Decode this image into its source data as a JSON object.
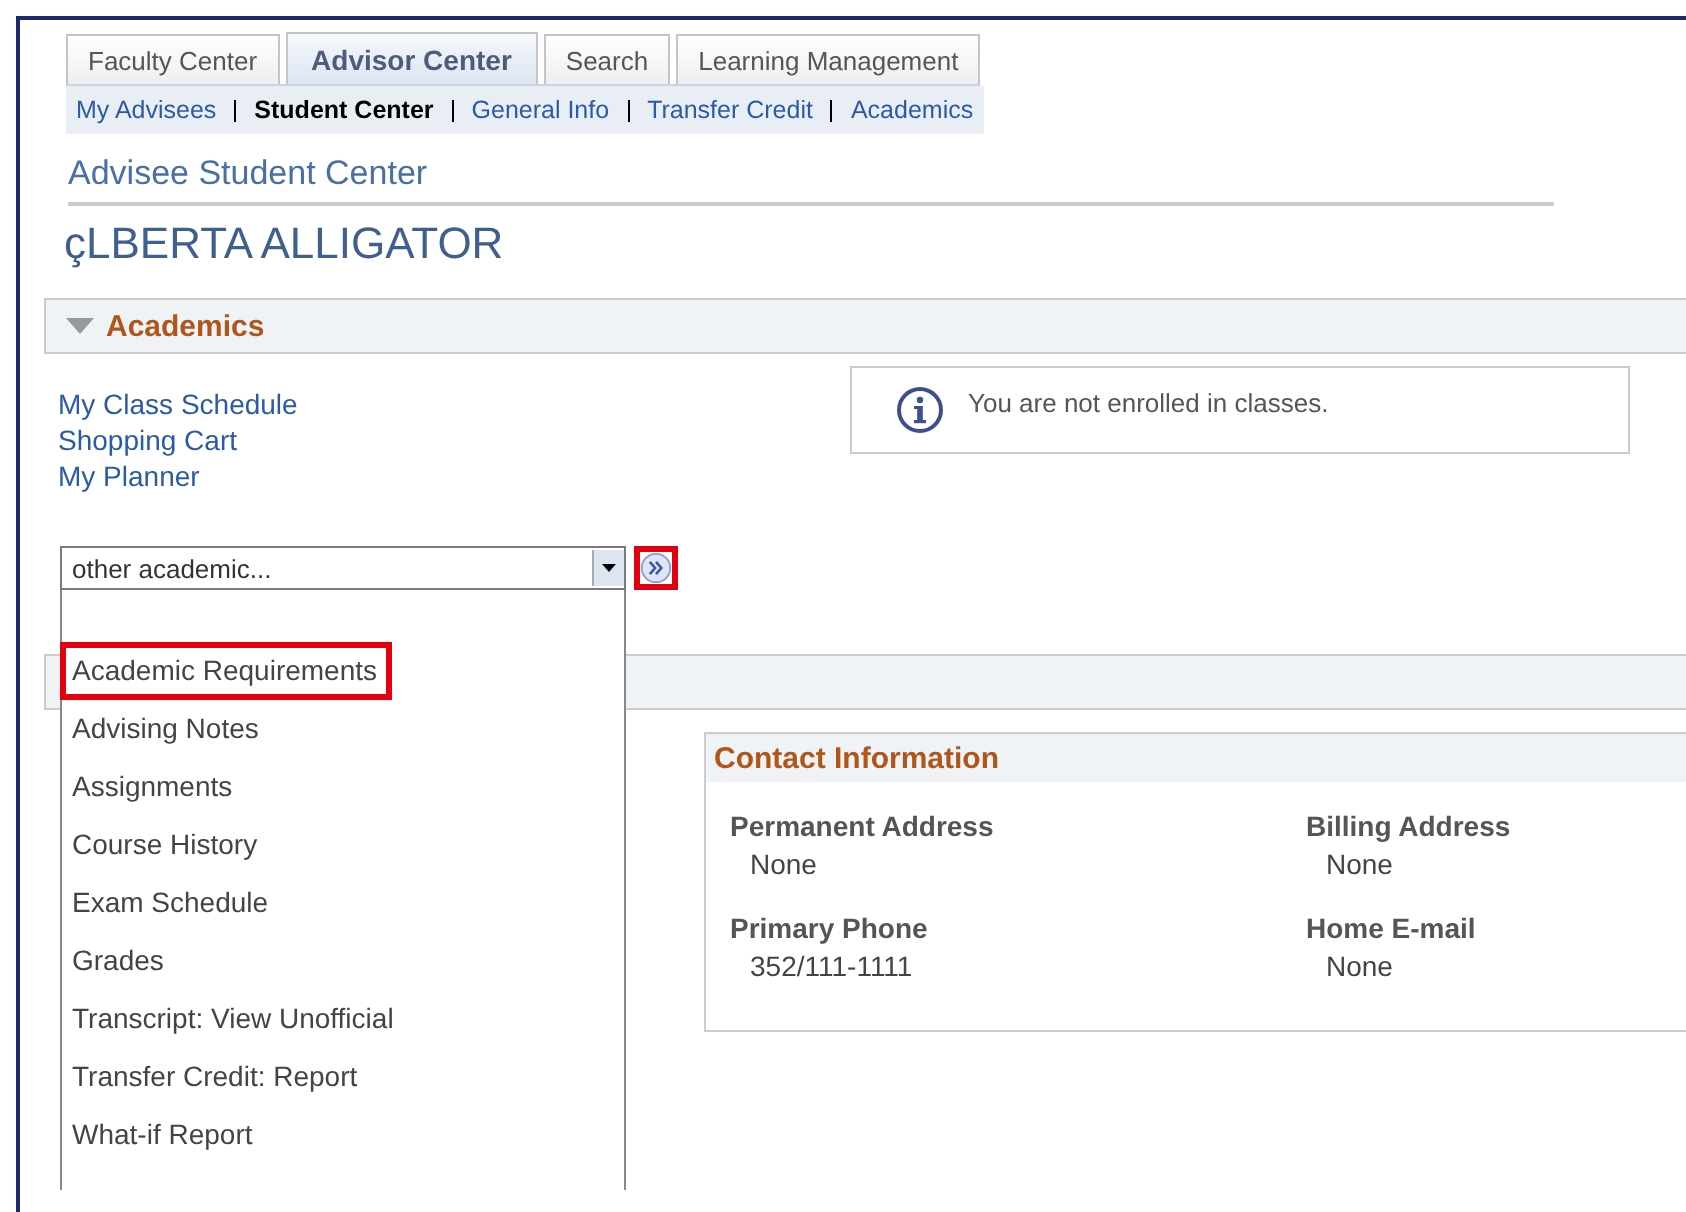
{
  "tabs": [
    {
      "label": "Faculty Center",
      "selected": false
    },
    {
      "label": "Advisor Center",
      "selected": true
    },
    {
      "label": "Search",
      "selected": false
    },
    {
      "label": "Learning Management",
      "selected": false
    }
  ],
  "subnav": [
    {
      "label": "My Advisees",
      "selected": false
    },
    {
      "label": "Student Center",
      "selected": true
    },
    {
      "label": "General Info",
      "selected": false
    },
    {
      "label": "Transfer Credit",
      "selected": false
    },
    {
      "label": "Academics",
      "selected": false
    }
  ],
  "page_title": "Advisee Student Center",
  "student_name": "çLBERTA ALLIGATOR",
  "section": {
    "title": "Academics",
    "expanded": true
  },
  "links": [
    "My Class Schedule",
    "Shopping Cart",
    "My Planner"
  ],
  "notice": "You are not enrolled in classes.",
  "dropdown": {
    "value": "other academic...",
    "expanded": true,
    "options": [
      {
        "label": "Academic Requirements",
        "highlighted": true
      },
      {
        "label": "Advising Notes",
        "highlighted": false
      },
      {
        "label": "Assignments",
        "highlighted": false
      },
      {
        "label": "Course History",
        "highlighted": false
      },
      {
        "label": "Exam Schedule",
        "highlighted": false
      },
      {
        "label": "Grades",
        "highlighted": false
      },
      {
        "label": "Transcript: View Unofficial",
        "highlighted": false
      },
      {
        "label": "Transfer Credit: Report",
        "highlighted": false
      },
      {
        "label": "What-if Report",
        "highlighted": false
      }
    ]
  },
  "go_button": {
    "highlighted": true
  },
  "contact": {
    "title": "Contact Information",
    "fields": [
      {
        "label": "Permanent Address",
        "value": "None"
      },
      {
        "label": "Billing Address",
        "value": "None"
      },
      {
        "label": "Primary Phone",
        "value": "352/111-1111"
      },
      {
        "label": "Home E-mail",
        "value": "None"
      }
    ]
  }
}
